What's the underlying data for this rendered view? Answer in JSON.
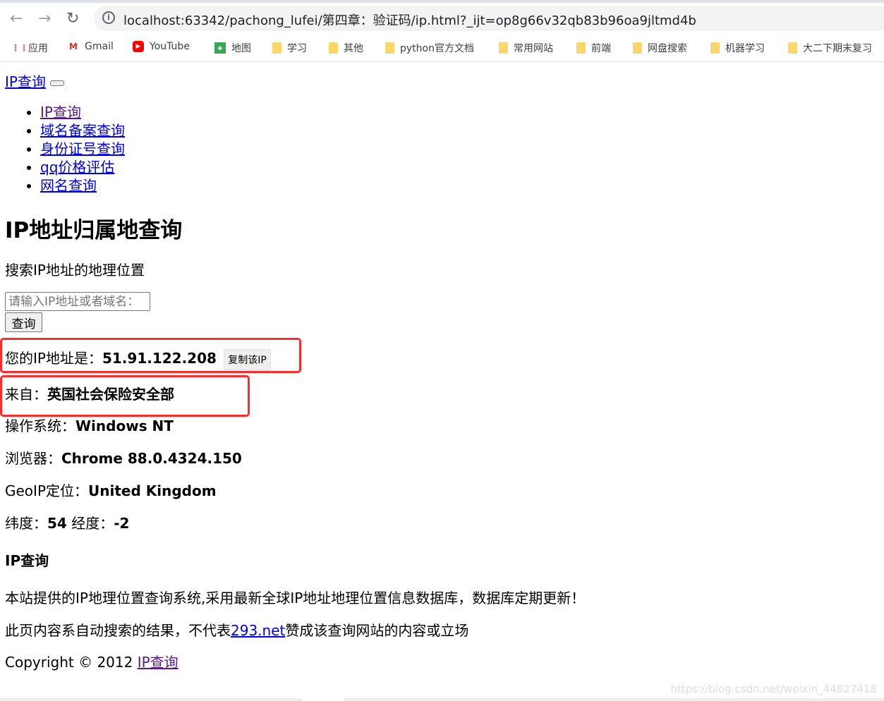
{
  "browser": {
    "url": "localhost:63342/pachong_lufei/第四章：验证码/ip.html?_ijt=op8g66v32qb83b96oa9jltmd4b",
    "bookmarks": [
      {
        "label": "应用",
        "icon": "apps-grid-icon"
      },
      {
        "label": "Gmail",
        "icon": "gmail-icon"
      },
      {
        "label": "YouTube",
        "icon": "youtube-icon"
      },
      {
        "label": "地图",
        "icon": "maps-icon"
      },
      {
        "label": "学习",
        "icon": "folder-icon"
      },
      {
        "label": "其他",
        "icon": "folder-icon"
      },
      {
        "label": "python官方文档",
        "icon": "folder-icon"
      },
      {
        "label": "常用网站",
        "icon": "folder-icon"
      },
      {
        "label": "前端",
        "icon": "folder-icon"
      },
      {
        "label": "网盘搜索",
        "icon": "folder-icon"
      },
      {
        "label": "机器学习",
        "icon": "folder-icon"
      },
      {
        "label": "大二下期末复习",
        "icon": "folder-icon"
      }
    ]
  },
  "page": {
    "brand": "IP查询",
    "nav": [
      "IP查询",
      "域名备案查询",
      "身份证号查询",
      "qq价格评估",
      "网名查询"
    ],
    "title": "IP地址归属地查询",
    "subtitle": "搜索IP地址的地理位置",
    "search_placeholder": "请输入IP地址或者域名：",
    "search_button": "查询",
    "ip_label": "您的IP地址是：",
    "ip_value": "51.91.122.208",
    "copy_button": "复制该IP",
    "from_label": "来自：",
    "from_value": "英国社会保险安全部",
    "os_label": "操作系统：",
    "os_value": "Windows NT",
    "browser_label": "浏览器：",
    "browser_value": "Chrome 88.0.4324.150",
    "geo_label": "GeoIP定位：",
    "geo_value": "United Kingdom",
    "lat_label": "纬度：",
    "lat_value": "54",
    "lon_label": " 经度：",
    "lon_value": "-2",
    "section_title": "IP查询",
    "desc": "本站提供的IP地理位置查询系统,采用最新全球IP地址地理位置信息数据库，数据库定期更新！",
    "disclaimer_pre": "此页内容系自动搜索的结果，不代表",
    "disclaimer_link": "293.net",
    "disclaimer_post": "赞成该查询网站的内容或立场",
    "copyright": "Copyright © 2012 ",
    "copyright_link": "IP查询"
  },
  "watermark": "https://blog.csdn.net/weixin_44827418",
  "colors": {
    "highlight": "#ff2a2a",
    "link": "#0000ee",
    "visited": "#551a8b"
  }
}
